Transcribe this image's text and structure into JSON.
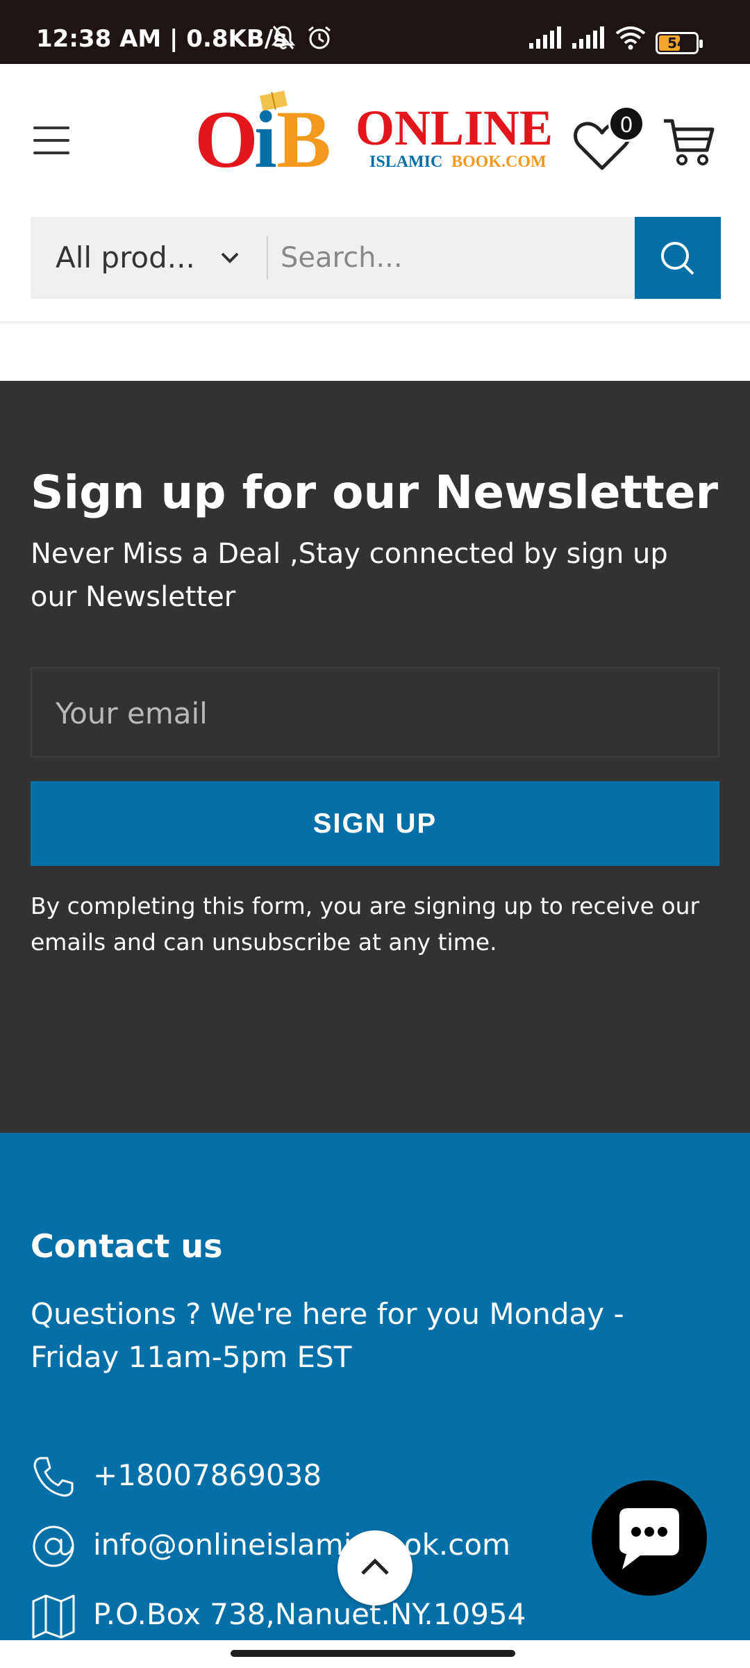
{
  "status_bar": {
    "time_speed": "12:38 AM | 0.8KB/s",
    "battery": "54",
    "icons": [
      "mute-bell-icon",
      "alarm-icon",
      "signal-icon",
      "signal-icon",
      "wifi-icon",
      "battery-icon"
    ]
  },
  "header": {
    "logo_letters": "OiB",
    "logo_word": "ONLINE",
    "logo_sub_left": "ISLAMIC",
    "logo_sub_right": "BOOK.COM",
    "wishlist_count": "0",
    "category_label": "All prod...",
    "search_placeholder": "Search..."
  },
  "newsletter": {
    "title": "Sign up for our Newsletter",
    "subtitle": "Never Miss a Deal ,Stay connected by sign up our Newsletter",
    "email_placeholder": "Your email",
    "button": "SIGN UP",
    "note": "By completing this form, you are signing up to receive our emails and can unsubscribe at any time."
  },
  "contact": {
    "title": "Contact us",
    "text": "Questions ? We're here for you Monday - Friday 11am-5pm EST",
    "phone": "+18007869038",
    "email": "info@onlineislamicbook.com",
    "address": "P.O.Box 738,Nanuet.NY.10954"
  },
  "colors": {
    "brand_blue": "#0570a8",
    "dark_section": "#323232",
    "logo_red": "#e3161c",
    "logo_orange": "#f39a1e"
  }
}
